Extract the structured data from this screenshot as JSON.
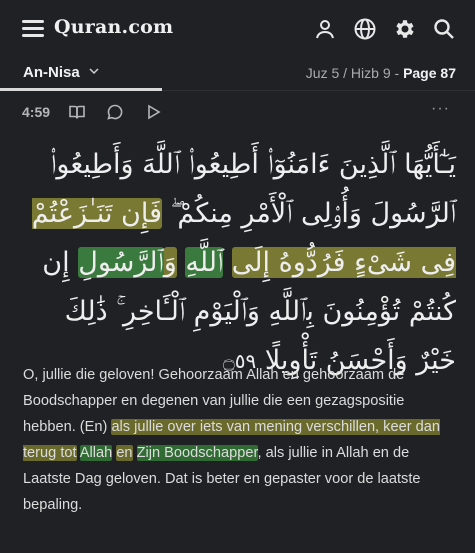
{
  "header": {
    "brand": "Quran.com",
    "icons": [
      "menu-icon",
      "user-icon",
      "globe-icon",
      "gear-icon",
      "search-icon"
    ]
  },
  "nav": {
    "surah": "An-Nisa",
    "juz_hizb": "Juz 5 / Hizb 9 - ",
    "page": "Page 87"
  },
  "verse": {
    "key": "4:59",
    "more": "···",
    "arabic": {
      "p1": "يَـٰٓأَيُّهَا ٱلَّذِينَ ءَامَنُوٓا۟ أَطِيعُوا۟ ٱللَّهَ وَأَطِيعُوا۟ ٱلرَّسُولَ وَأُو۟لِى ٱلْأَمْرِ مِنكُمْ ۖ ",
      "h1": "فَإِن تَنَـٰزَعْتُمْ فِى شَىْءٍ فَرُدُّوهُ إِلَى",
      "s1": " ",
      "h2": "ٱللَّهِ",
      "s2": " ",
      "h3": "وَ",
      "h4": "ٱلرَّسُولِ",
      "p2": " إِن كُنتُمْ تُؤْمِنُونَ بِٱللَّهِ وَٱلْيَوْمِ ٱلْـَٔاخِرِ ۚ ذَٰلِكَ خَيْرٌ وَأَحْسَنُ تَأْوِيلًا ",
      "end": "۝٥٩"
    },
    "translation": {
      "p1": "O, jullie die geloven! Gehoorzaam Allah en gehoorzaam de Boodschapper en degenen van jullie die een gezagspositie hebben. (En) ",
      "h1": "als jullie over iets van mening verschillen, keer dan terug tot",
      "s1": " ",
      "h2": "Allah",
      "s2": " ",
      "h3": "en",
      "s3": " ",
      "h4": "Zijn Boodschapper",
      "p2": ", als jullie in Allah en de Laatste Dag geloven. Dat is beter en gepaster voor de laatste bepaling."
    }
  },
  "colors": {
    "background": "#1f2125",
    "highlight_yellow": "#7a7934",
    "highlight_green": "#3b7a3e"
  }
}
